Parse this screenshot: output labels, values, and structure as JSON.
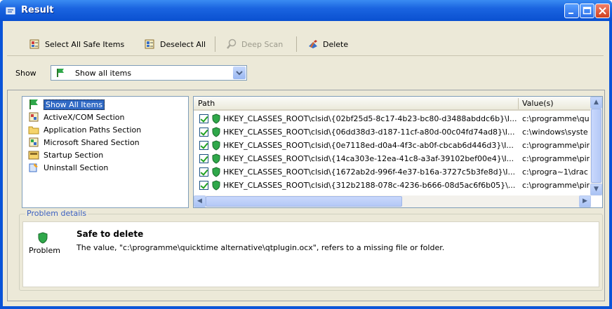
{
  "window": {
    "title": "Result"
  },
  "toolbar": {
    "select_all_label": "Select All Safe Items",
    "deselect_all_label": "Deselect All",
    "deep_scan_label": "Deep Scan",
    "delete_label": "Delete"
  },
  "filter": {
    "label": "Show",
    "selected": "Show all items"
  },
  "tree": {
    "items": [
      {
        "label": "Show All Items",
        "icon": "flag-icon",
        "selected": true
      },
      {
        "label": "ActiveX/COM Section",
        "icon": "component-icon"
      },
      {
        "label": "Application Paths Section",
        "icon": "folder-icon"
      },
      {
        "label": "Microsoft Shared Section",
        "icon": "component-icon"
      },
      {
        "label": "Startup Section",
        "icon": "startup-icon"
      },
      {
        "label": "Uninstall Section",
        "icon": "uninstall-icon"
      }
    ]
  },
  "list": {
    "columns": [
      "Path",
      "Value(s)"
    ],
    "rows": [
      {
        "path": "HKEY_CLASSES_ROOT\\clsid\\{02bf25d5-8c17-4b23-bc80-d3488abddc6b}\\I...",
        "value": "c:\\programme\\qu"
      },
      {
        "path": "HKEY_CLASSES_ROOT\\clsid\\{06dd38d3-d187-11cf-a80d-00c04fd74ad8}\\I...",
        "value": "c:\\windows\\syste"
      },
      {
        "path": "HKEY_CLASSES_ROOT\\clsid\\{0e7118ed-d0a4-4f3c-ab0f-cbcab6d446d3}\\I...",
        "value": "c:\\programme\\pir"
      },
      {
        "path": "HKEY_CLASSES_ROOT\\clsid\\{14ca303e-12ea-41c8-a3af-39102bef00e4}\\I...",
        "value": "c:\\programme\\pir"
      },
      {
        "path": "HKEY_CLASSES_ROOT\\clsid\\{1672ab2d-996f-4e37-b16a-3727c5b3fe8d}\\I...",
        "value": "c:\\progra~1\\drac"
      },
      {
        "path": "HKEY_CLASSES_ROOT\\clsid\\{312b2188-078c-4236-b666-08d5ac6f6b05}\\...",
        "value": "c:\\programme\\pir"
      }
    ]
  },
  "details": {
    "group_title": "Problem details",
    "problem_label": "Problem",
    "heading": "Safe to delete",
    "message": "The value, \"c:\\programme\\quicktime alternative\\qtplugin.ocx\", refers to a missing file or folder."
  },
  "colors": {
    "titlebar": "#0a54d8",
    "selection": "#316ac5",
    "window_bg": "#ece9d8",
    "shield_green": "#2fa84a"
  }
}
